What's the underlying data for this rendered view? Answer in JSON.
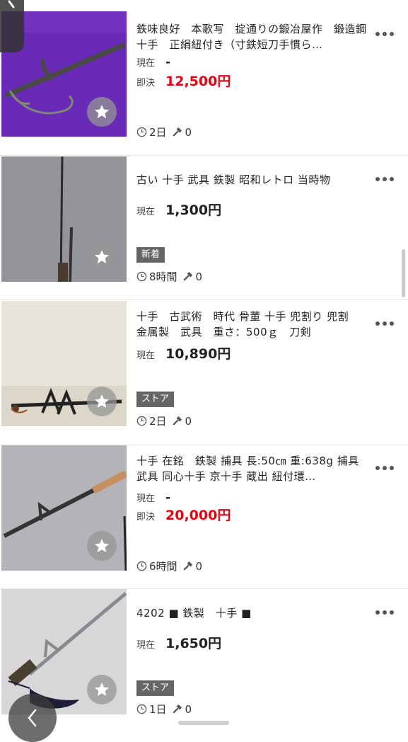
{
  "labels": {
    "current": "現在",
    "buyout": "即決",
    "dash": "-"
  },
  "colors": {
    "price_red": "#e60012",
    "badge_bg": "#666666"
  },
  "items": [
    {
      "title": "鉄味良好　本歌写　掟通りの鍛冶屋作　鍛造鋼十手　正絹紐付き（寸鉄短刀手慣ら…",
      "current": "-",
      "buyout": "12,500円",
      "badge": "",
      "time_left": "2日",
      "bids": "0"
    },
    {
      "title": "古い 十手 武具 鉄製 昭和レトロ 当時物",
      "current": "1,300円",
      "buyout": "",
      "badge": "新着",
      "time_left": "8時間",
      "bids": "0"
    },
    {
      "title": "十手　古武術　時代 骨董 十手 兜割り 兜割　金属製　武具　重さ：500ｇ　刀剣",
      "current": "10,890円",
      "buyout": "",
      "badge": "ストア",
      "time_left": "2日",
      "bids": "0"
    },
    {
      "title": "十手 在銘　鉄製 捕具 長:50㎝ 重:638g 捕具 武具 同心十手 京十手 蔵出 紐付環…",
      "current": "-",
      "buyout": "20,000円",
      "badge": "",
      "time_left": "6時間",
      "bids": "0"
    },
    {
      "title": "4202 ■ 鉄製　十手 ■",
      "current": "1,650円",
      "buyout": "",
      "badge": "ストア",
      "time_left": "1日",
      "bids": "0"
    }
  ]
}
